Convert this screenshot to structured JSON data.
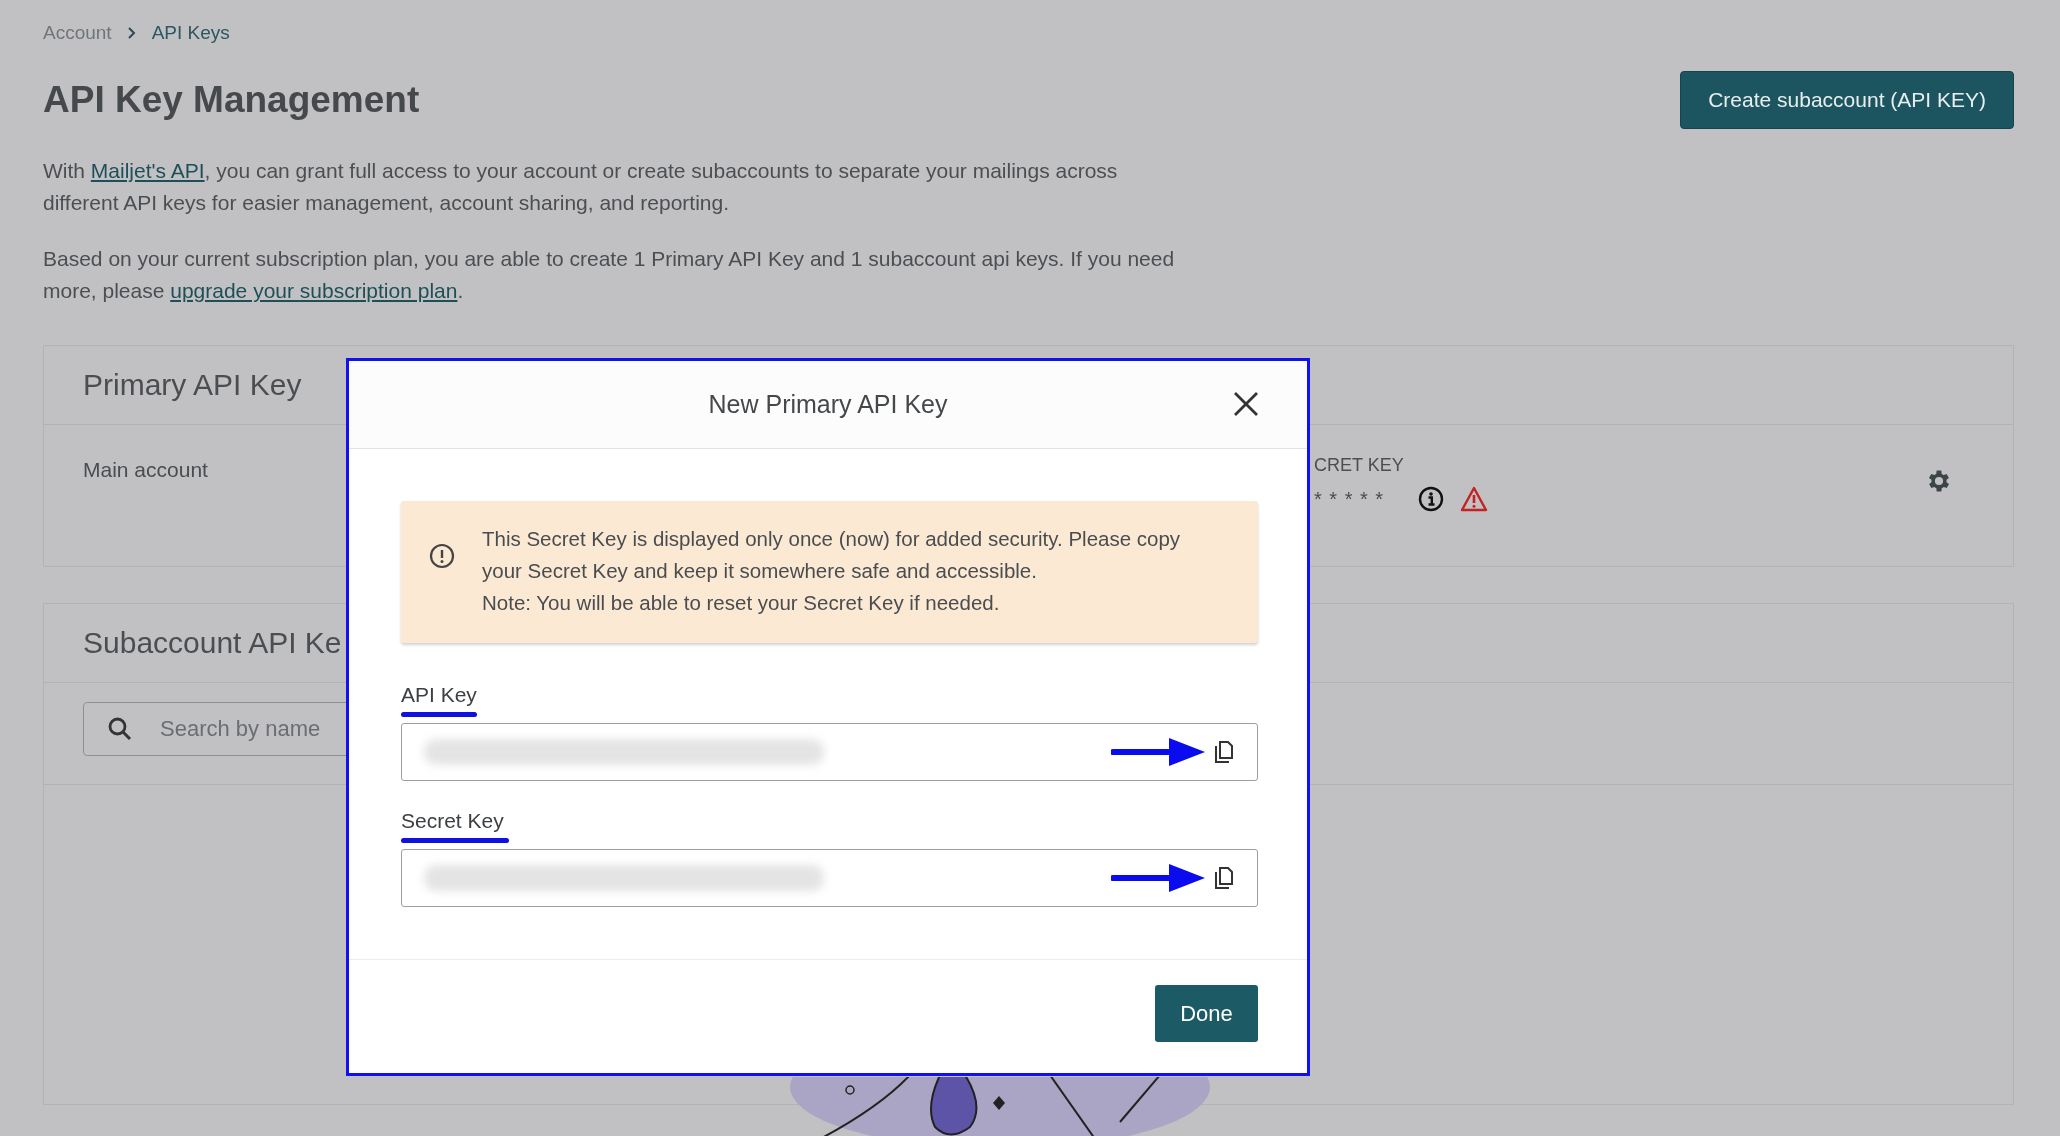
{
  "breadcrumb": [
    {
      "label": "Account",
      "current": false
    },
    {
      "label": "API Keys",
      "current": true
    }
  ],
  "page_title": "API Key Management",
  "create_button": "Create subaccount (API KEY)",
  "intro": [
    [
      {
        "text": "With "
      },
      {
        "text": "Mailjet's API",
        "link": true
      },
      {
        "text": ", you can grant full access to your account or create subaccounts to separate your mailings across different API keys for easier management, account sharing, and reporting."
      }
    ],
    [
      {
        "text": "Based on your current subscription plan, you are able to create 1 Primary API Key and 1 subaccount api keys. If you need more, please "
      },
      {
        "text": "upgrade your subscription plan",
        "link": true
      },
      {
        "text": "."
      }
    ]
  ],
  "primary_section": {
    "title": "Primary API Key",
    "account": "Main account",
    "secret_key_label": "CRET KEY",
    "secret_key_value": "* * * * *"
  },
  "subaccount_section": {
    "title": "Subaccount API Ke",
    "search": {
      "placeholder": "Search by name"
    }
  },
  "modal": {
    "title": "New Primary API Key",
    "notice": [
      "This Secret Key is displayed only once (now) for added security. Please copy your Secret Key and keep it somewhere safe and accessible.",
      "Note: You will be able to reset your Secret Key if needed."
    ],
    "fields": [
      {
        "label": "API Key"
      },
      {
        "label": "Secret Key"
      }
    ],
    "done_button": "Done"
  }
}
